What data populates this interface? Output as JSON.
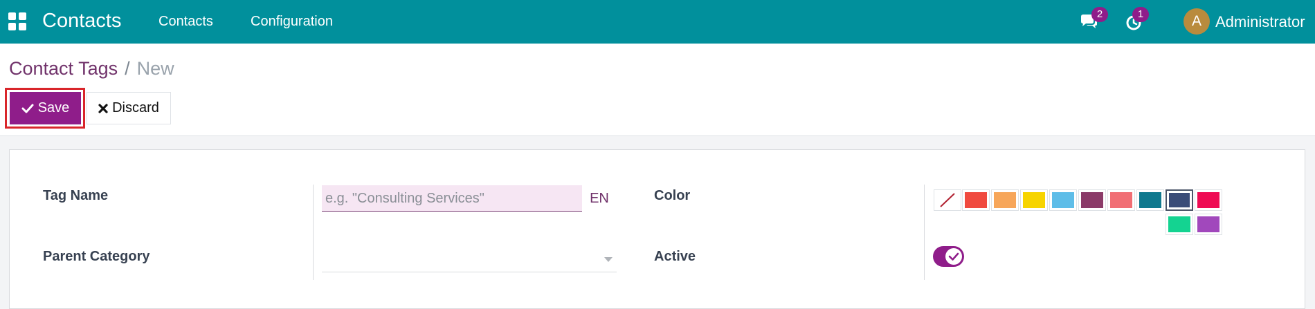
{
  "navbar": {
    "app_title": "Contacts",
    "menus": [
      "Contacts",
      "Configuration"
    ],
    "chat_badge": "2",
    "activity_badge": "1",
    "avatar_initial": "A",
    "user_name": "Administrator",
    "bg_color": "#01909c"
  },
  "breadcrumb": {
    "parent": "Contact Tags",
    "separator": "/",
    "current": "New"
  },
  "buttons": {
    "save_label": "Save",
    "discard_label": "Discard"
  },
  "form": {
    "tag_name_label": "Tag Name",
    "tag_name_placeholder": "e.g. \"Consulting Services\"",
    "tag_name_value": "",
    "lang_label": "EN",
    "parent_category_label": "Parent Category",
    "parent_category_value": "",
    "color_label": "Color",
    "active_label": "Active",
    "active_value": true,
    "colors": [
      {
        "name": "no-color",
        "hex": "#ffffff"
      },
      {
        "name": "red",
        "hex": "#f04a3f"
      },
      {
        "name": "orange",
        "hex": "#f7a65a"
      },
      {
        "name": "yellow",
        "hex": "#f7d400"
      },
      {
        "name": "light-blue",
        "hex": "#5ebde8"
      },
      {
        "name": "dark-purple",
        "hex": "#8b3a68"
      },
      {
        "name": "salmon-pink",
        "hex": "#f16e74"
      },
      {
        "name": "medium-blue",
        "hex": "#10798e"
      },
      {
        "name": "dark-blue",
        "hex": "#3a4c78"
      },
      {
        "name": "fuchsia",
        "hex": "#ef0b53"
      },
      {
        "name": "green",
        "hex": "#14d391"
      },
      {
        "name": "purple",
        "hex": "#a148bc"
      }
    ],
    "selected_color": "dark-blue"
  }
}
